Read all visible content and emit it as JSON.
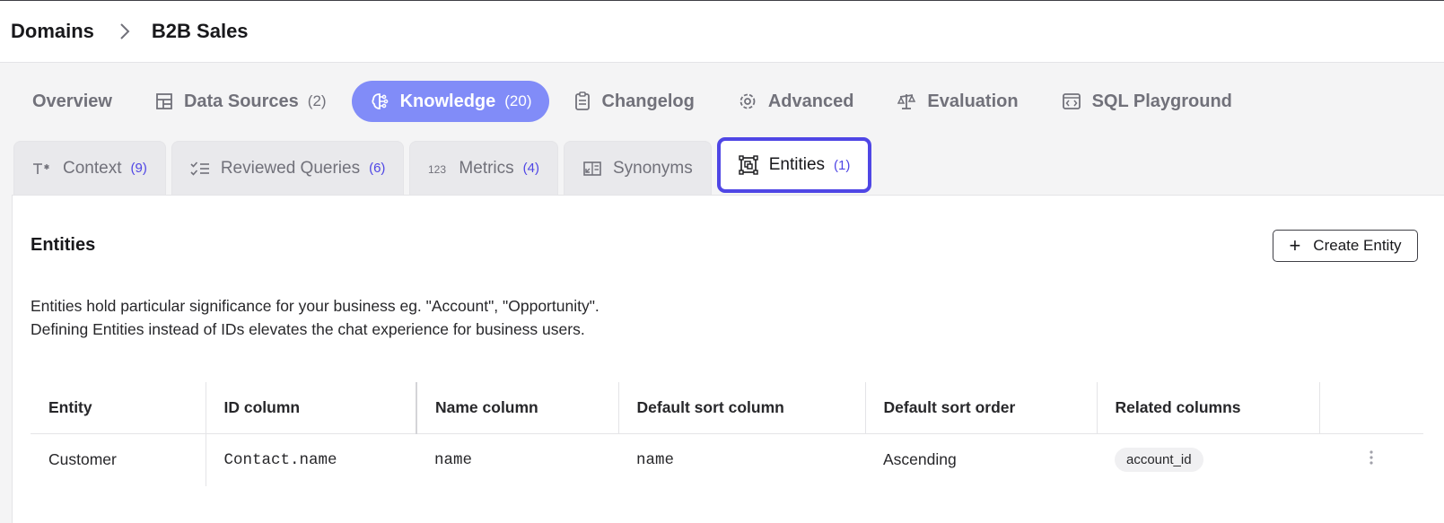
{
  "breadcrumb": {
    "root": "Domains",
    "current": "B2B Sales"
  },
  "main_tabs": [
    {
      "label": "Overview",
      "count": "",
      "icon": "none"
    },
    {
      "label": "Data Sources",
      "count": "(2)",
      "icon": "layout-icon"
    },
    {
      "label": "Knowledge",
      "count": "(20)",
      "icon": "brain-icon",
      "active": true
    },
    {
      "label": "Changelog",
      "count": "",
      "icon": "clipboard-icon"
    },
    {
      "label": "Advanced",
      "count": "",
      "icon": "gear-icon"
    },
    {
      "label": "Evaluation",
      "count": "",
      "icon": "scale-icon"
    },
    {
      "label": "SQL Playground",
      "count": "",
      "icon": "code-window-icon"
    }
  ],
  "sub_tabs": [
    {
      "label": "Context",
      "count": "(9)",
      "icon": "text-icon"
    },
    {
      "label": "Reviewed Queries",
      "count": "(6)",
      "icon": "checklist-icon"
    },
    {
      "label": "Metrics",
      "count": "(4)",
      "icon": "numbers-icon"
    },
    {
      "label": "Synonyms",
      "count": "",
      "icon": "book-icon"
    },
    {
      "label": "Entities",
      "count": "(1)",
      "icon": "entity-icon",
      "active": true
    }
  ],
  "panel": {
    "title": "Entities",
    "create_label": "Create Entity",
    "description_line1": "Entities hold particular significance for your business eg. \"Account\", \"Opportunity\".",
    "description_line2": "Defining Entities instead of IDs elevates the chat experience for business users."
  },
  "table": {
    "headers": [
      "Entity",
      "ID column",
      "Name column",
      "Default sort column",
      "Default sort order",
      "Related columns"
    ],
    "rows": [
      {
        "entity": "Customer",
        "id_column": "Contact.name",
        "name_column": "name",
        "sort_column": "name",
        "sort_order": "Ascending",
        "related": "account_id"
      }
    ]
  },
  "colors": {
    "accent": "#4f46e5",
    "active_pill": "#818cf8"
  }
}
